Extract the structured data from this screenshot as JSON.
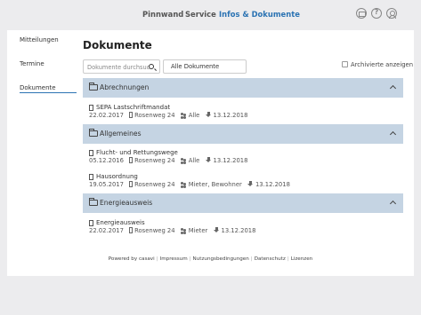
{
  "header": {
    "nav": [
      {
        "label": "Pinnwand"
      },
      {
        "label": "Service"
      },
      {
        "label": "Infos & Dokumente",
        "active": true
      }
    ],
    "icons": [
      "mail-icon",
      "help-icon",
      "user-icon"
    ]
  },
  "sidebar": {
    "items": [
      {
        "label": "Mitteilungen"
      },
      {
        "label": "Termine"
      },
      {
        "label": "Dokumente",
        "active": true
      }
    ]
  },
  "main": {
    "title": "Dokumente",
    "search": {
      "placeholder": "Dokumente durchsuchen",
      "value": ""
    },
    "filter": {
      "selected": "Alle Dokumente"
    },
    "archive_label": "Archivierte anzeigen",
    "archive_checked": false,
    "sections": [
      {
        "title": "Abrechnungen",
        "docs": [
          {
            "name": "SEPA Lastschriftmandat",
            "date": "22.02.2017",
            "building": "Rosenweg 24",
            "audience": "Alle",
            "published": "13.12.2018"
          }
        ]
      },
      {
        "title": "Allgemeines",
        "docs": [
          {
            "name": "Flucht- und Rettungswege",
            "date": "05.12.2016",
            "building": "Rosenweg 24",
            "audience": "Alle",
            "published": "13.12.2018"
          },
          {
            "name": "Hausordnung",
            "date": "19.05.2017",
            "building": "Rosenweg 24",
            "audience": "Mieter, Bewohner",
            "published": "13.12.2018"
          }
        ]
      },
      {
        "title": "Energieausweis",
        "docs": [
          {
            "name": "Energieausweis",
            "date": "22.02.2017",
            "building": "Rosenweg 24",
            "audience": "Mieter",
            "published": "13.12.2018"
          }
        ]
      }
    ]
  },
  "footer": {
    "powered": "Powered by casavi",
    "links": [
      "Impressum",
      "Nutzungsbedingungen",
      "Datenschutz",
      "Lizenzen"
    ]
  },
  "colors": {
    "accent": "#2b73b3",
    "section_header_bg": "#c5d4e3",
    "page_bg": "#ececee"
  }
}
